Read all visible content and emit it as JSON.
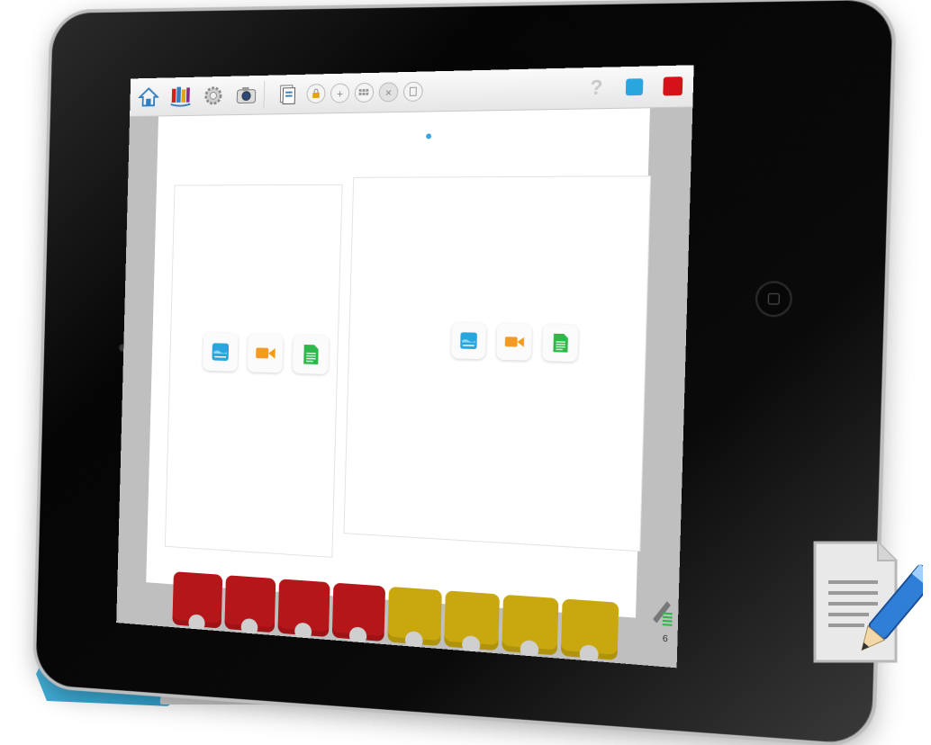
{
  "toolbar": {
    "icons": [
      "home-icon",
      "books-icon",
      "gears-icon",
      "camera-icon",
      "pages-icon",
      "lock-icon",
      "plus-icon",
      "grid-icon",
      "close-icon",
      "page-icon",
      "help-icon",
      "blue-square-icon",
      "red-square-icon"
    ],
    "help_label": "?"
  },
  "panels": {
    "left": {
      "media": [
        "image-icon",
        "video-icon",
        "text-icon"
      ]
    },
    "right": {
      "media": [
        "image-icon",
        "video-icon",
        "text-icon"
      ]
    }
  },
  "bottom_strip": {
    "tile_colors": [
      "#b5161a",
      "#b5161a",
      "#b5161a",
      "#b5161a",
      "#c9a80f",
      "#c9a80f",
      "#c9a80f",
      "#c9a80f",
      "#c9a80f"
    ]
  },
  "footer": {
    "page_number": "6"
  },
  "colors": {
    "accent_blue": "#2aa6de",
    "accent_red": "#d51119",
    "accent_green": "#2fb84a",
    "accent_orange": "#f39a21",
    "cover_blue": "#4fb9e2"
  }
}
